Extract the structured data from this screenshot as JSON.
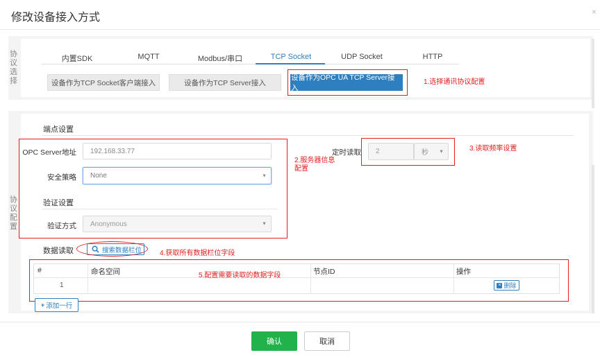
{
  "dialog": {
    "title": "修改设备接入方式",
    "close_icon": "close-icon"
  },
  "protocol_section": {
    "side_label": "协议选择"
  },
  "tabs": [
    {
      "label": "内置SDK"
    },
    {
      "label": "MQTT"
    },
    {
      "label": "Modbus/串口"
    },
    {
      "label": "TCP Socket",
      "active": true
    },
    {
      "label": "UDP Socket"
    },
    {
      "label": "HTTP"
    }
  ],
  "modes": [
    {
      "label": "设备作为TCP Socket客户端接入"
    },
    {
      "label": "设备作为TCP Server接入"
    },
    {
      "label": "设备作为OPC UA TCP Server接入",
      "active": true
    }
  ],
  "config_section": {
    "side_label": "协议配置"
  },
  "endpoint": {
    "title": "端点设置",
    "server_label": "OPC Server地址",
    "server_value": "192.168.33.77",
    "policy_label": "安全策略",
    "policy_value": "None"
  },
  "auth": {
    "title": "验证设置",
    "method_label": "验证方式",
    "method_value": "Anonymous"
  },
  "timer": {
    "label": "定时读取",
    "value": "2",
    "unit": "秒"
  },
  "data_read": {
    "title": "数据读取",
    "search_button": "搜索数据栏位",
    "columns": [
      "#",
      "命名空间",
      "节点ID",
      "操作"
    ],
    "rows": [
      {
        "index": "1",
        "namespace": "",
        "node_id": "",
        "action": "删除"
      }
    ],
    "add_row": "添加一行"
  },
  "annotations": {
    "a1": "1.选择通讯协议配置",
    "a2_line1": "2.服务器信息",
    "a2_line2": "配置",
    "a3": "3.读取频率设置",
    "a4": "4.获取所有数据栏位字段",
    "a5": "5.配置需要读取的数据字段"
  },
  "footer": {
    "confirm": "确认",
    "cancel": "取消"
  },
  "colors": {
    "accent": "#2d7fc0",
    "confirm": "#22b24c",
    "annotation": "#e02020"
  }
}
